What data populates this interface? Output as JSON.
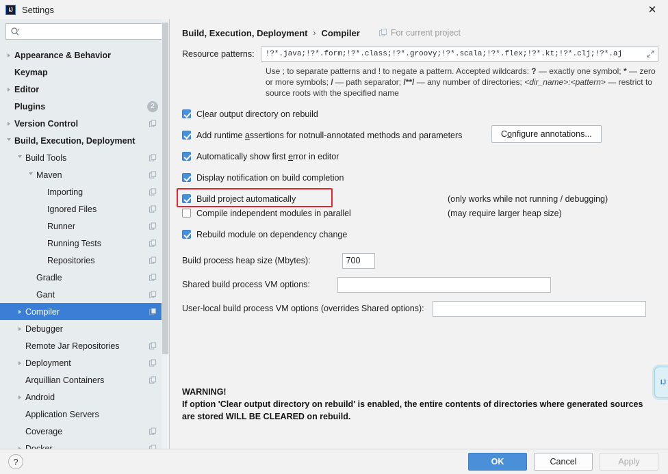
{
  "window": {
    "title": "Settings",
    "app_icon": "IJ",
    "close_icon": "✕"
  },
  "sidebar": {
    "search": {
      "value": "",
      "placeholder": "",
      "icon": "search-icon"
    },
    "items": [
      {
        "label": "Appearance & Behavior",
        "indent": 0,
        "arrow": "right",
        "bold": true,
        "project_icon": false,
        "selected": false
      },
      {
        "label": "Keymap",
        "indent": 0,
        "arrow": "none",
        "bold": true,
        "project_icon": false,
        "selected": false
      },
      {
        "label": "Editor",
        "indent": 0,
        "arrow": "right",
        "bold": true,
        "project_icon": false,
        "selected": false
      },
      {
        "label": "Plugins",
        "indent": 0,
        "arrow": "none",
        "bold": true,
        "project_icon": false,
        "selected": false,
        "badge": "2"
      },
      {
        "label": "Version Control",
        "indent": 0,
        "arrow": "right",
        "bold": true,
        "project_icon": true,
        "selected": false
      },
      {
        "label": "Build, Execution, Deployment",
        "indent": 0,
        "arrow": "down",
        "bold": true,
        "project_icon": false,
        "selected": false
      },
      {
        "label": "Build Tools",
        "indent": 1,
        "arrow": "down",
        "bold": false,
        "project_icon": true,
        "selected": false
      },
      {
        "label": "Maven",
        "indent": 2,
        "arrow": "down",
        "bold": false,
        "project_icon": true,
        "selected": false
      },
      {
        "label": "Importing",
        "indent": 3,
        "arrow": "none",
        "bold": false,
        "project_icon": true,
        "selected": false
      },
      {
        "label": "Ignored Files",
        "indent": 3,
        "arrow": "none",
        "bold": false,
        "project_icon": true,
        "selected": false
      },
      {
        "label": "Runner",
        "indent": 3,
        "arrow": "none",
        "bold": false,
        "project_icon": true,
        "selected": false
      },
      {
        "label": "Running Tests",
        "indent": 3,
        "arrow": "none",
        "bold": false,
        "project_icon": true,
        "selected": false
      },
      {
        "label": "Repositories",
        "indent": 3,
        "arrow": "none",
        "bold": false,
        "project_icon": true,
        "selected": false
      },
      {
        "label": "Gradle",
        "indent": 2,
        "arrow": "none",
        "bold": false,
        "project_icon": true,
        "selected": false
      },
      {
        "label": "Gant",
        "indent": 2,
        "arrow": "none",
        "bold": false,
        "project_icon": true,
        "selected": false
      },
      {
        "label": "Compiler",
        "indent": 1,
        "arrow": "right",
        "bold": false,
        "project_icon": true,
        "selected": true
      },
      {
        "label": "Debugger",
        "indent": 1,
        "arrow": "right",
        "bold": false,
        "project_icon": false,
        "selected": false
      },
      {
        "label": "Remote Jar Repositories",
        "indent": 1,
        "arrow": "none",
        "bold": false,
        "project_icon": true,
        "selected": false
      },
      {
        "label": "Deployment",
        "indent": 1,
        "arrow": "right",
        "bold": false,
        "project_icon": true,
        "selected": false
      },
      {
        "label": "Arquillian Containers",
        "indent": 1,
        "arrow": "none",
        "bold": false,
        "project_icon": true,
        "selected": false
      },
      {
        "label": "Android",
        "indent": 1,
        "arrow": "right",
        "bold": false,
        "project_icon": false,
        "selected": false
      },
      {
        "label": "Application Servers",
        "indent": 1,
        "arrow": "none",
        "bold": false,
        "project_icon": false,
        "selected": false
      },
      {
        "label": "Coverage",
        "indent": 1,
        "arrow": "none",
        "bold": false,
        "project_icon": true,
        "selected": false
      },
      {
        "label": "Docker",
        "indent": 1,
        "arrow": "right",
        "bold": false,
        "project_icon": true,
        "selected": false
      }
    ]
  },
  "breadcrumb": {
    "parent": "Build, Execution, Deployment",
    "separator": "›",
    "current": "Compiler",
    "scope_label": "For current project",
    "scope_icon": "project-scope-icon"
  },
  "resource_patterns": {
    "label": "Resource patterns:",
    "value": "!?*.java;!?*.form;!?*.class;!?*.groovy;!?*.scala;!?*.flex;!?*.kt;!?*.clj;!?*.aj",
    "placeholder": "",
    "expand_icon": "expand-icon",
    "hint_line1_a": "Use ; to separate patterns and ! to negate a pattern. Accepted wildcards: ",
    "hint_wildcard1": "?",
    "hint_line1_b": " — exactly one symbol; ",
    "hint_wildcard2": "*",
    "hint_line1_c": " — zero or more symbols; ",
    "hint_wildcard3": "/",
    "hint_line1_d": " — path separator; ",
    "hint_wildcard4": "/**/",
    "hint_line1_e": " — any number of directories; ",
    "hint_dirname": "<dir_name>:<pattern>",
    "hint_line1_f": " — restrict to source roots with the specified name"
  },
  "checkboxes": [
    {
      "label_pre": "C",
      "label_mn": "l",
      "label_post": "ear output directory on rebuild",
      "checked": true,
      "note": ""
    },
    {
      "label_pre": "Add runtime ",
      "label_mn": "a",
      "label_post": "ssertions for notnull-annotated methods and parameters",
      "checked": true,
      "note": ""
    },
    {
      "label_pre": "Automatically show first ",
      "label_mn": "e",
      "label_post": "rror in editor",
      "checked": true,
      "note": ""
    },
    {
      "label_pre": "Display notification on build completion",
      "label_mn": "",
      "label_post": "",
      "checked": true,
      "note": ""
    },
    {
      "label_pre": "Build project automatically",
      "label_mn": "",
      "label_post": "",
      "checked": true,
      "note": "(only works while not running / debugging)"
    },
    {
      "label_pre": "Compile independent modules in parallel",
      "label_mn": "",
      "label_post": "",
      "checked": false,
      "note": "(may require larger heap size)"
    },
    {
      "label_pre": "Rebuild module on dependency change",
      "label_mn": "",
      "label_post": "",
      "checked": true,
      "note": ""
    }
  ],
  "configure_annotations": {
    "pre": "C",
    "mn": "o",
    "post": "nfigure annotations..."
  },
  "options": {
    "heap_label": "Build process heap size (Mbytes):",
    "heap_value": "700",
    "shared_vm_label": "Shared build process VM options:",
    "shared_vm_value": "",
    "user_vm_label": "User-local build process VM options (overrides Shared options):",
    "user_vm_value": ""
  },
  "warning": {
    "title": "WARNING!",
    "body": "If option 'Clear output directory on rebuild' is enabled, the entire contents of directories where generated sources are stored WILL BE CLEARED on rebuild."
  },
  "edge_widget": {
    "label": "IJ"
  },
  "footer": {
    "help_icon": "?",
    "ok_label": "OK",
    "cancel_label": "Cancel",
    "apply_label": "Apply"
  },
  "colors": {
    "accent": "#4a90d9",
    "selection": "#3a7fd5",
    "highlight": "#e8232a",
    "sidebar_bg": "#e7ecee",
    "pane_bg": "#f2f2f2"
  }
}
